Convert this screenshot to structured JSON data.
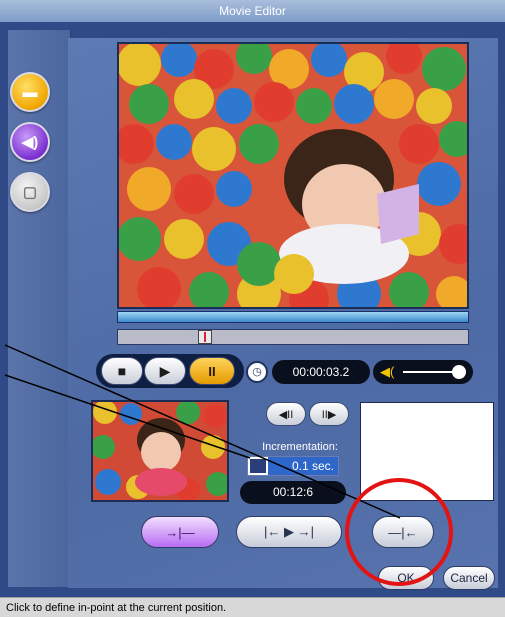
{
  "window": {
    "title": "Movie Editor"
  },
  "sidebar": {
    "items": [
      {
        "name": "edit-tool",
        "icon": "clip-edit-icon",
        "glyph": "▬"
      },
      {
        "name": "audio-tool",
        "icon": "speaker-icon",
        "glyph": "◀)"
      },
      {
        "name": "effects-tool",
        "icon": "effects-icon",
        "glyph": "▢"
      }
    ]
  },
  "transport": {
    "stop_glyph": "■",
    "play_glyph": "▶",
    "pause_glyph": "II",
    "time": "00:00:03.2",
    "clock_glyph": "◷",
    "volume_glyph": "◀("
  },
  "increment": {
    "step_back_glyph": "◀II",
    "step_fwd_glyph": "II▶",
    "label": "Incrementation:",
    "value": "0.1 sec.",
    "duration": "00:12:6"
  },
  "edit_buttons": {
    "in_point_glyph": "→|—",
    "play_range_glyph": "|← ▶ →|",
    "out_point_glyph": "—|←"
  },
  "dialog": {
    "ok_label": "OK",
    "cancel_label": "Cancel"
  },
  "status": {
    "text": "Click to define in-point at the current position."
  },
  "colors": {
    "accent": "#e31313",
    "panel": "#4d6aa4",
    "pause": "#f0a500"
  }
}
